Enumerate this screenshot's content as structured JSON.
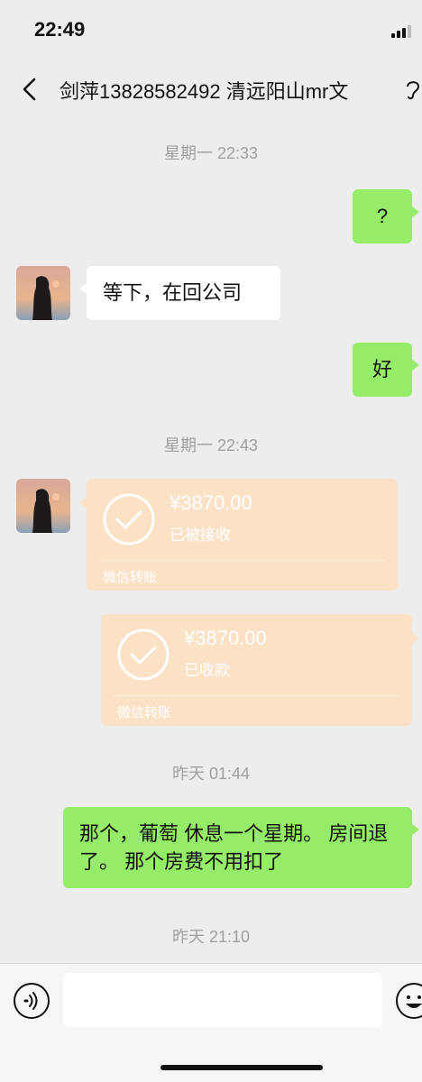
{
  "status_bar": {
    "time": "22:49",
    "signal_icon": "signal-bars-icon"
  },
  "header": {
    "back_icon": "chevron-left-icon",
    "title": "剑萍13828582492 清远阳山mr文",
    "ear_icon": "ear-icon"
  },
  "messages": {
    "timestamp_1": "星期一 22:33",
    "msg_1": "?",
    "msg_2": "等下，在回公司",
    "msg_3": "好",
    "timestamp_2": "星期一 22:43",
    "transfer_1": {
      "amount": "¥3870.00",
      "status": "已被接收",
      "label": "微信转账"
    },
    "transfer_2": {
      "amount": "¥3870.00",
      "status": "已收款",
      "label": "微信转账"
    },
    "timestamp_3": "昨天 01:44",
    "msg_4": "那个，葡萄 休息一个星期。 房间退了。  那个房费不用扣了",
    "timestamp_4": "昨天 21:10"
  },
  "input_bar": {
    "voice_icon": "voice-icon",
    "text_value": "",
    "emoji_icon": "emoji-icon"
  },
  "colors": {
    "sent_bubble": "#95ec69",
    "received_bubble": "#ffffff",
    "transfer_card": "#fbe2c7",
    "background": "#ededed"
  }
}
